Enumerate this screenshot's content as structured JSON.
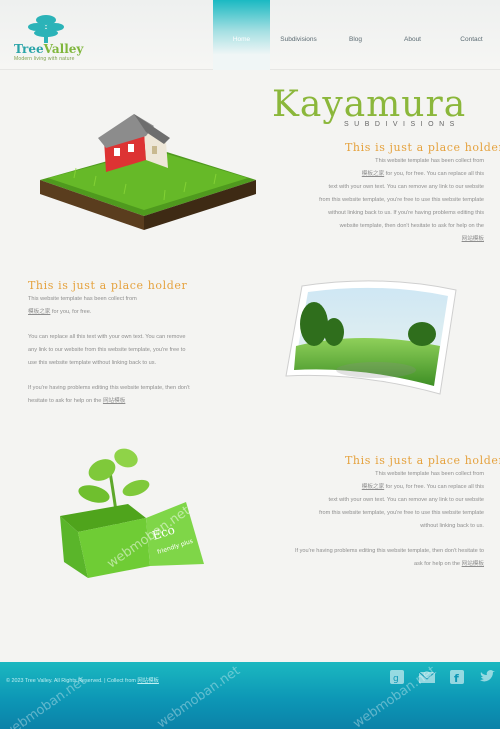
{
  "header": {
    "logo": {
      "name_part1": "Tree",
      "name_part2": "Valley",
      "tagline": "Modern living with nature"
    },
    "nav": [
      {
        "label": "Home",
        "active": true
      },
      {
        "label": "Subdivisions",
        "active": false
      },
      {
        "label": "Blog",
        "active": false
      },
      {
        "label": "About",
        "active": false
      },
      {
        "label": "Contact",
        "active": false
      }
    ]
  },
  "brand": {
    "title": "Kayamura",
    "subtitle": "SUBDIVISIONS"
  },
  "sections": [
    {
      "title": "This is just a place holder",
      "lines": [
        "This website template has been collect from",
        "for you, for free. You can replace all this",
        "text with your own text. You can remove any link to our website",
        "from this website template, you're free to use this website template",
        "without linking back to us. If you're having problems editing this",
        "website template, then don't hesitate to ask for help on the"
      ],
      "link1": "模板之家",
      "link2": "网站模板"
    },
    {
      "title": "This is just a place holder",
      "lines": [
        "This website template has been collect from",
        "for you, for free.",
        "You can replace all this text with your own text. You can remove",
        "any link to our website from this website template, you're free to",
        "use this website template without linking back to us.",
        "If you're having problems editing this website template, then don't",
        "hesitate to ask for help on the"
      ],
      "link1": "模板之家",
      "link2": "网站模板"
    },
    {
      "title": "This is just a place holder",
      "lines": [
        "This website template has been collect from",
        "for you, for free. You can replace all this",
        "text with your own text. You can remove any link to our website",
        "from this website template, you're free to use this website template",
        "without linking back to us.",
        "If you're having problems editing this website template, then don't hesitate to",
        "ask for help on the"
      ],
      "link1": "模板之家",
      "link2": "网站模板"
    }
  ],
  "illustrations": {
    "box_label_1": "Eco",
    "box_label_2": "friendly plus"
  },
  "footer": {
    "copyright": "© 2023 Tree Valley. All Rights Reserved. | Collect from",
    "copyright_link": "网站模板",
    "icons": [
      "google-plus-icon",
      "mail-icon",
      "facebook-icon",
      "twitter-icon"
    ]
  },
  "watermark": "webmoban.net",
  "colors": {
    "accent_orange": "#e5a23e",
    "brand_green": "#8bb73b",
    "footer_teal": "#0d97b6",
    "nav_active": "#1ab9c2"
  }
}
